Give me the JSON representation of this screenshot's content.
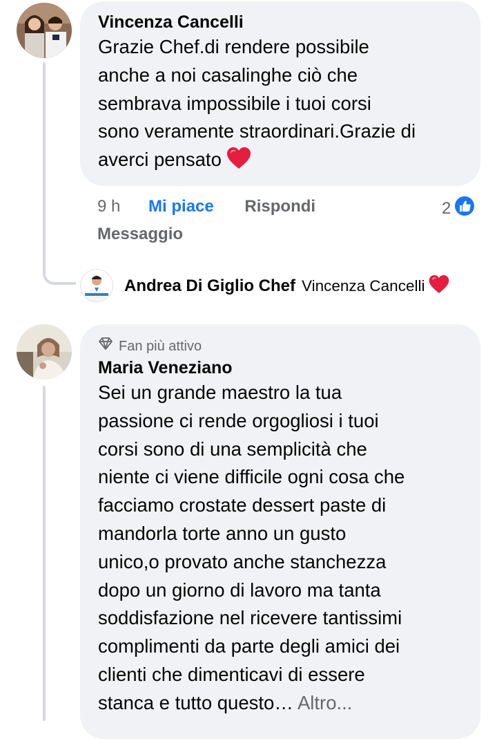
{
  "comments": [
    {
      "author": "Vincenza Cancelli",
      "text_lines": [
        "Grazie Chef.di rendere possibile",
        "anche a noi casalinghe ciò che",
        "sembrava impossibile i tuoi corsi",
        "sono veramente straordinari.Grazie di",
        "averci pensato"
      ],
      "emoji": "heart",
      "time": "9 h",
      "like_label": "Mi piace",
      "reply_label": "Rispondi",
      "message_label": "Messaggio",
      "reaction_count": "2",
      "reaction_icon": "like-icon"
    },
    {
      "badge_icon": "diamond-icon",
      "badge": "Fan più attivo",
      "author": "Maria Veneziano",
      "text_lines": [
        "Sei un grande maestro la tua",
        "passione ci rende orgogliosi i tuoi",
        "corsi sono di una semplicità che",
        "niente ci viene difficile ogni cosa che",
        "facciamo crostate dessert paste di",
        "mandorla torte anno un gusto",
        "unico,o provato anche stanchezza",
        "dopo un giorno di lavoro ma tanta",
        "soddisfazione nel ricevere tantissimi",
        "complimenti da parte degli amici dei",
        "clienti che dimenticavi di essere",
        "stanca e tutto questo…"
      ],
      "more_label": "Altro..."
    }
  ],
  "reply": {
    "author": "Andrea Di Giglio Chef",
    "text": "Vincenza Cancelli",
    "emoji": "heart"
  },
  "colors": {
    "bubble": "#f0f2f5",
    "like_blue": "#1877f2",
    "secondary_text": "#65676b",
    "heart_red": "#e41e3f",
    "thread_line": "#d6d9dd"
  }
}
